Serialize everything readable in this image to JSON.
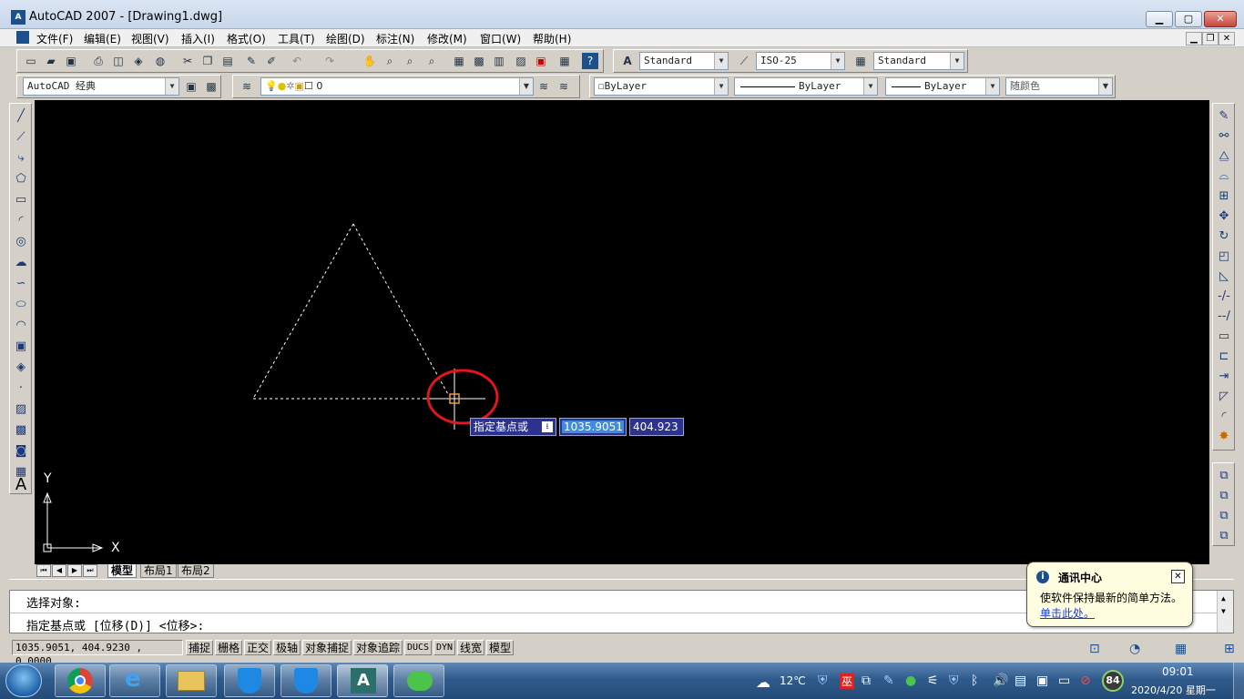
{
  "window": {
    "title": "AutoCAD 2007 - [Drawing1.dwg]",
    "app_icon": "autocad-icon"
  },
  "menu": [
    "文件(F)",
    "编辑(E)",
    "视图(V)",
    "插入(I)",
    "格式(O)",
    "工具(T)",
    "绘图(D)",
    "标注(N)",
    "修改(M)",
    "窗口(W)",
    "帮助(H)"
  ],
  "toolbar": {
    "text_style": "Standard",
    "dim_style": "ISO-25",
    "table_style": "Standard",
    "workspace": "AutoCAD 经典",
    "layer": "0",
    "color": "ByLayer",
    "linetype": "ByLayer",
    "lineweight": "ByLayer",
    "plot_style": "随颜色"
  },
  "canvas": {
    "background": "#000000",
    "dyn_prompt": "指定基点或",
    "dyn_x": "1035.9051",
    "dyn_y": "404.923",
    "ucs_x": "X",
    "ucs_y": "Y"
  },
  "layout_tabs": [
    "模型",
    "布局1",
    "布局2"
  ],
  "command_lines": [
    "选择对象:",
    "指定基点或 [位移(D)] <位移>:"
  ],
  "status": {
    "coords": "1035.9051, 404.9230 , 0.0000",
    "buttons": [
      "捕捉",
      "栅格",
      "正交",
      "极轴",
      "对象捕捉",
      "对象追踪",
      "DUCS",
      "DYN",
      "线宽",
      "模型"
    ]
  },
  "notification": {
    "title": "通讯中心",
    "body": "使软件保持最新的简单方法。",
    "link": "单击此处。"
  },
  "taskbar": {
    "apps": [
      "start-orb",
      "chrome",
      "internet-explorer",
      "file-explorer",
      "security-shield",
      "security-shield-2",
      "autocad",
      "wechat"
    ],
    "weather": "12℃",
    "badge": "84",
    "time": "09:01",
    "date": "2020/4/20 星期一"
  },
  "colors": {
    "accent": "#1d4f8a",
    "highlight_circle": "#e3161b",
    "dyn_bg": "#2b3290"
  }
}
